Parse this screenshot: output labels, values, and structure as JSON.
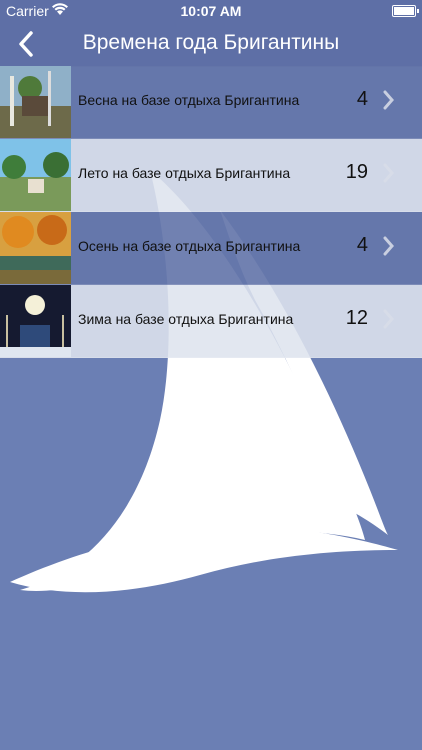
{
  "status_bar": {
    "carrier": "Carrier",
    "time": "10:07 AM"
  },
  "nav": {
    "back_label": "<",
    "title": "Времена года Бригантины"
  },
  "items": [
    {
      "label": "Весна на базе отдыха Бригантина",
      "count": "4",
      "thumb_icon": "spring-photo"
    },
    {
      "label": "Лето на базе отдыха Бригантина",
      "count": "19",
      "thumb_icon": "summer-photo"
    },
    {
      "label": "Осень на базе отдыха Бригантина",
      "count": "4",
      "thumb_icon": "autumn-photo"
    },
    {
      "label": "Зима на базе отдыха Бригантина",
      "count": "12",
      "thumb_icon": "winter-photo"
    }
  ],
  "colors": {
    "background": "#6b7fb4",
    "nav": "#5e6fa6",
    "sail": "#ffffff"
  }
}
